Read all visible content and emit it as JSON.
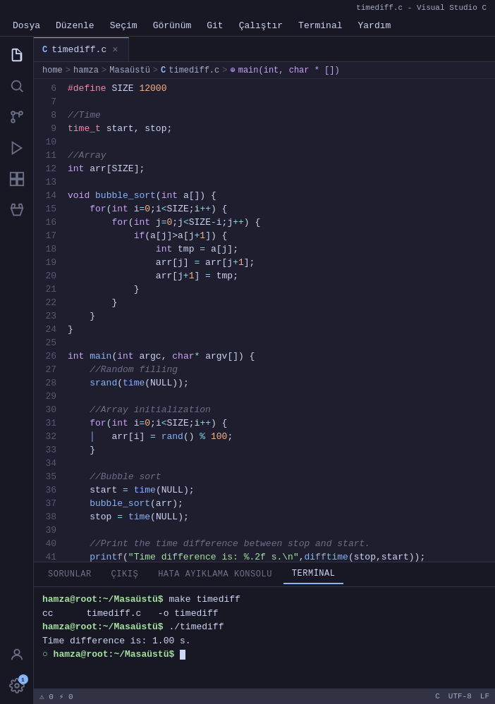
{
  "titlebar": {
    "text": "timediff.c - Visual Studio C"
  },
  "menubar": {
    "items": [
      {
        "label": "Dosya",
        "id": "menu-file"
      },
      {
        "label": "Düzenle",
        "id": "menu-edit"
      },
      {
        "label": "Seçim",
        "id": "menu-selection"
      },
      {
        "label": "Görünüm",
        "id": "menu-view"
      },
      {
        "label": "Git",
        "id": "menu-git"
      },
      {
        "label": "Çalıştır",
        "id": "menu-run"
      },
      {
        "label": "Terminal",
        "id": "menu-terminal"
      },
      {
        "label": "Yardım",
        "id": "menu-help"
      }
    ]
  },
  "tab": {
    "filename": "timediff.c",
    "language_icon": "C"
  },
  "breadcrumb": {
    "home": "home",
    "user": "hamza",
    "folder": "Masaüstü",
    "file": "timediff.c",
    "func": "main(int, char * [])"
  },
  "panel": {
    "tabs": [
      {
        "label": "SORUNLAR",
        "id": "tab-problems"
      },
      {
        "label": "ÇIKIŞ",
        "id": "tab-output"
      },
      {
        "label": "HATA AYIKLAMA KONSOLU",
        "id": "tab-debug"
      },
      {
        "label": "TERMİNAL",
        "id": "tab-terminal",
        "active": true
      }
    ]
  },
  "terminal": {
    "lines": [
      {
        "type": "prompt_cmd",
        "prompt": "hamza@root:~/Masaüstü$ ",
        "cmd": "make timediff"
      },
      {
        "type": "output",
        "text": "cc\t\ttimediff.c\t-o timediff"
      },
      {
        "type": "prompt_cmd",
        "prompt": "hamza@root:~/Masaüstü$ ",
        "cmd": "./timediff"
      },
      {
        "type": "output",
        "text": "Time difference is: 1.00 s."
      },
      {
        "type": "prompt_cursor",
        "prompt": "hamza@root:~/Masaüstü$ "
      }
    ]
  },
  "statusbar": {
    "errors": "0",
    "warnings": "0",
    "notifications": "1"
  },
  "activity_bar": {
    "icons": [
      {
        "name": "files-icon",
        "symbol": "⎘",
        "active": true
      },
      {
        "name": "search-icon",
        "symbol": "🔍",
        "active": false
      },
      {
        "name": "source-control-icon",
        "symbol": "⑂",
        "active": false
      },
      {
        "name": "run-icon",
        "symbol": "▷",
        "active": false
      },
      {
        "name": "extensions-icon",
        "symbol": "⊞",
        "active": false
      },
      {
        "name": "testing-icon",
        "symbol": "⊙",
        "active": false
      }
    ],
    "bottom_icons": [
      {
        "name": "account-icon",
        "symbol": "👤"
      },
      {
        "name": "settings-icon",
        "symbol": "⚙",
        "notification": "1"
      }
    ]
  }
}
